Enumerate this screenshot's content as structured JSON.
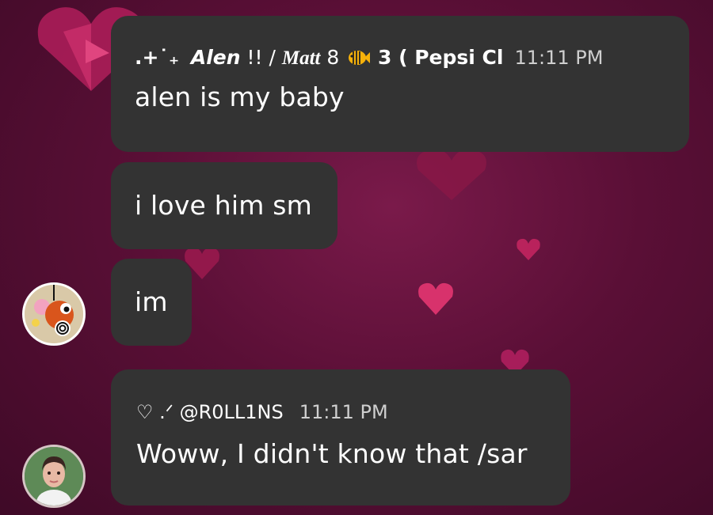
{
  "messages": [
    {
      "sender_prefix": ".+˙₊",
      "sender_main": "Alen",
      "sender_mid": " !! / ",
      "sender_serif": "Matt",
      "sender_tail": " 8 ",
      "fish_icon": "tropical-fish-icon",
      "sender_tail2": " 3 ( Pepsi Cl",
      "time": "11:11 PM",
      "text": "alen is my baby"
    },
    {
      "text": "i love him sm"
    },
    {
      "text": "im"
    },
    {
      "sender": "♡ .ᐟ @R0LL1NS",
      "time": "11:11 PM",
      "text": "Woww, I didn't know that /sar"
    }
  ],
  "colors": {
    "bubble": "#333333",
    "background": "#5a0f36",
    "time": "#cfcfcf"
  }
}
